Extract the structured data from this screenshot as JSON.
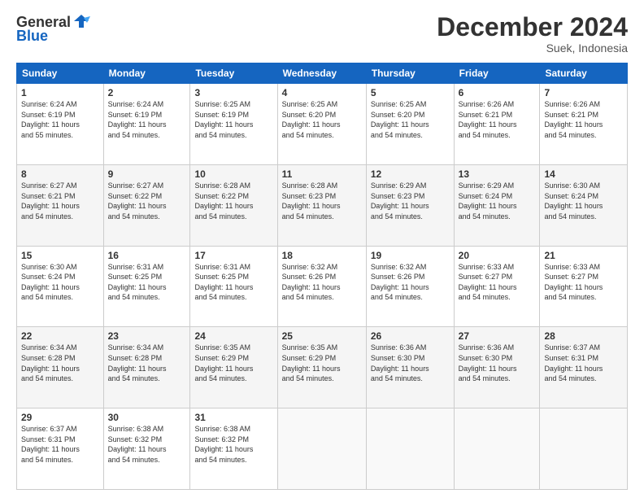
{
  "header": {
    "logo_general": "General",
    "logo_blue": "Blue",
    "title": "December 2024",
    "location": "Suek, Indonesia"
  },
  "days_of_week": [
    "Sunday",
    "Monday",
    "Tuesday",
    "Wednesday",
    "Thursday",
    "Friday",
    "Saturday"
  ],
  "weeks": [
    [
      {
        "day": "1",
        "info": "Sunrise: 6:24 AM\nSunset: 6:19 PM\nDaylight: 11 hours\nand 55 minutes."
      },
      {
        "day": "2",
        "info": "Sunrise: 6:24 AM\nSunset: 6:19 PM\nDaylight: 11 hours\nand 54 minutes."
      },
      {
        "day": "3",
        "info": "Sunrise: 6:25 AM\nSunset: 6:19 PM\nDaylight: 11 hours\nand 54 minutes."
      },
      {
        "day": "4",
        "info": "Sunrise: 6:25 AM\nSunset: 6:20 PM\nDaylight: 11 hours\nand 54 minutes."
      },
      {
        "day": "5",
        "info": "Sunrise: 6:25 AM\nSunset: 6:20 PM\nDaylight: 11 hours\nand 54 minutes."
      },
      {
        "day": "6",
        "info": "Sunrise: 6:26 AM\nSunset: 6:21 PM\nDaylight: 11 hours\nand 54 minutes."
      },
      {
        "day": "7",
        "info": "Sunrise: 6:26 AM\nSunset: 6:21 PM\nDaylight: 11 hours\nand 54 minutes."
      }
    ],
    [
      {
        "day": "8",
        "info": "Sunrise: 6:27 AM\nSunset: 6:21 PM\nDaylight: 11 hours\nand 54 minutes."
      },
      {
        "day": "9",
        "info": "Sunrise: 6:27 AM\nSunset: 6:22 PM\nDaylight: 11 hours\nand 54 minutes."
      },
      {
        "day": "10",
        "info": "Sunrise: 6:28 AM\nSunset: 6:22 PM\nDaylight: 11 hours\nand 54 minutes."
      },
      {
        "day": "11",
        "info": "Sunrise: 6:28 AM\nSunset: 6:23 PM\nDaylight: 11 hours\nand 54 minutes."
      },
      {
        "day": "12",
        "info": "Sunrise: 6:29 AM\nSunset: 6:23 PM\nDaylight: 11 hours\nand 54 minutes."
      },
      {
        "day": "13",
        "info": "Sunrise: 6:29 AM\nSunset: 6:24 PM\nDaylight: 11 hours\nand 54 minutes."
      },
      {
        "day": "14",
        "info": "Sunrise: 6:30 AM\nSunset: 6:24 PM\nDaylight: 11 hours\nand 54 minutes."
      }
    ],
    [
      {
        "day": "15",
        "info": "Sunrise: 6:30 AM\nSunset: 6:24 PM\nDaylight: 11 hours\nand 54 minutes."
      },
      {
        "day": "16",
        "info": "Sunrise: 6:31 AM\nSunset: 6:25 PM\nDaylight: 11 hours\nand 54 minutes."
      },
      {
        "day": "17",
        "info": "Sunrise: 6:31 AM\nSunset: 6:25 PM\nDaylight: 11 hours\nand 54 minutes."
      },
      {
        "day": "18",
        "info": "Sunrise: 6:32 AM\nSunset: 6:26 PM\nDaylight: 11 hours\nand 54 minutes."
      },
      {
        "day": "19",
        "info": "Sunrise: 6:32 AM\nSunset: 6:26 PM\nDaylight: 11 hours\nand 54 minutes."
      },
      {
        "day": "20",
        "info": "Sunrise: 6:33 AM\nSunset: 6:27 PM\nDaylight: 11 hours\nand 54 minutes."
      },
      {
        "day": "21",
        "info": "Sunrise: 6:33 AM\nSunset: 6:27 PM\nDaylight: 11 hours\nand 54 minutes."
      }
    ],
    [
      {
        "day": "22",
        "info": "Sunrise: 6:34 AM\nSunset: 6:28 PM\nDaylight: 11 hours\nand 54 minutes."
      },
      {
        "day": "23",
        "info": "Sunrise: 6:34 AM\nSunset: 6:28 PM\nDaylight: 11 hours\nand 54 minutes."
      },
      {
        "day": "24",
        "info": "Sunrise: 6:35 AM\nSunset: 6:29 PM\nDaylight: 11 hours\nand 54 minutes."
      },
      {
        "day": "25",
        "info": "Sunrise: 6:35 AM\nSunset: 6:29 PM\nDaylight: 11 hours\nand 54 minutes."
      },
      {
        "day": "26",
        "info": "Sunrise: 6:36 AM\nSunset: 6:30 PM\nDaylight: 11 hours\nand 54 minutes."
      },
      {
        "day": "27",
        "info": "Sunrise: 6:36 AM\nSunset: 6:30 PM\nDaylight: 11 hours\nand 54 minutes."
      },
      {
        "day": "28",
        "info": "Sunrise: 6:37 AM\nSunset: 6:31 PM\nDaylight: 11 hours\nand 54 minutes."
      }
    ],
    [
      {
        "day": "29",
        "info": "Sunrise: 6:37 AM\nSunset: 6:31 PM\nDaylight: 11 hours\nand 54 minutes."
      },
      {
        "day": "30",
        "info": "Sunrise: 6:38 AM\nSunset: 6:32 PM\nDaylight: 11 hours\nand 54 minutes."
      },
      {
        "day": "31",
        "info": "Sunrise: 6:38 AM\nSunset: 6:32 PM\nDaylight: 11 hours\nand 54 minutes."
      },
      {
        "day": "",
        "info": ""
      },
      {
        "day": "",
        "info": ""
      },
      {
        "day": "",
        "info": ""
      },
      {
        "day": "",
        "info": ""
      }
    ]
  ]
}
